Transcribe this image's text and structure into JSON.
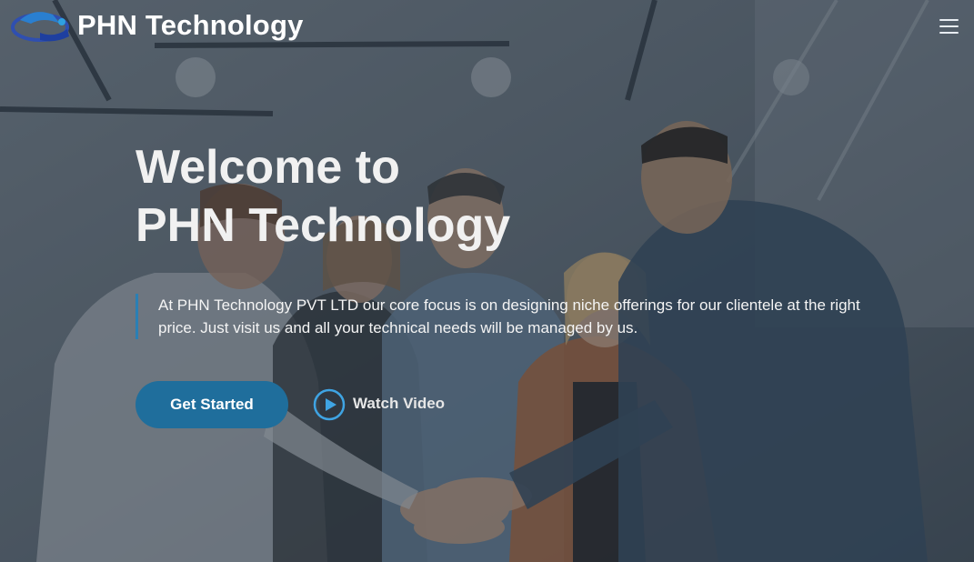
{
  "header": {
    "brand": "PHN Technology",
    "logo_icon": "swoosh-globe-logo",
    "menu_icon": "hamburger-menu-icon"
  },
  "hero": {
    "title_line1": "Welcome to",
    "title_line2": "PHN Technology",
    "description": "At PHN Technology PVT LTD our core focus is on designing niche offerings for our clientele at the right price. Just visit us and all your technical needs will be managed by us.",
    "cta_label": "Get Started",
    "video_label": "Watch Video",
    "video_icon": "play-circle-icon"
  },
  "colors": {
    "accent": "#1f6e9c",
    "play_icon": "#3fa4e3",
    "text": "#ffffff"
  }
}
